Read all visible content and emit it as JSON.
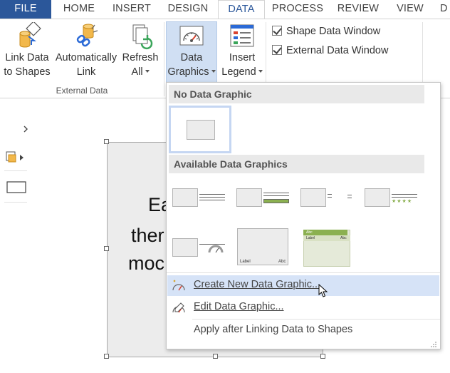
{
  "tabs": {
    "file": "FILE",
    "home": "HOME",
    "insert": "INSERT",
    "design": "DESIGN",
    "data": "DATA",
    "process": "PROCESS",
    "review": "REVIEW",
    "view": "VIEW",
    "overflow": "D"
  },
  "ribbon": {
    "link_data": {
      "line1": "Link Data",
      "line2": "to Shapes"
    },
    "auto_link": {
      "line1": "Automatically",
      "line2": "Link"
    },
    "refresh_all": {
      "line1": "Refresh",
      "line2": "All"
    },
    "data_graphics": {
      "line1": "Data",
      "line2": "Graphics"
    },
    "insert_legend": {
      "line1": "Insert",
      "line2": "Legend"
    },
    "group_label": "External Data",
    "checkboxes": [
      {
        "label": "Shape Data Window",
        "checked": true
      },
      {
        "label": "External Data Window",
        "checked": true
      }
    ]
  },
  "canvas": {
    "shape_text_lines": [
      "Ea",
      "ther",
      "moc"
    ]
  },
  "dropdown": {
    "no_graphic_header": "No Data Graphic",
    "available_header": "Available Data Graphics",
    "thumb_text": {
      "label": "Label",
      "abc": "Abc",
      "stars": "★★★★"
    },
    "menu": {
      "create": "Create New Data Graphic...",
      "edit": "Edit Data Graphic...",
      "apply": "Apply after Linking Data to Shapes"
    }
  },
  "colors": {
    "file_tab": "#2b579a",
    "accent_text": "#2b579a",
    "selected_fill": "#d0dff3",
    "hover_fill": "#d6e3f7",
    "green_bar": "#8bb050",
    "star_color": "#8bb050"
  }
}
